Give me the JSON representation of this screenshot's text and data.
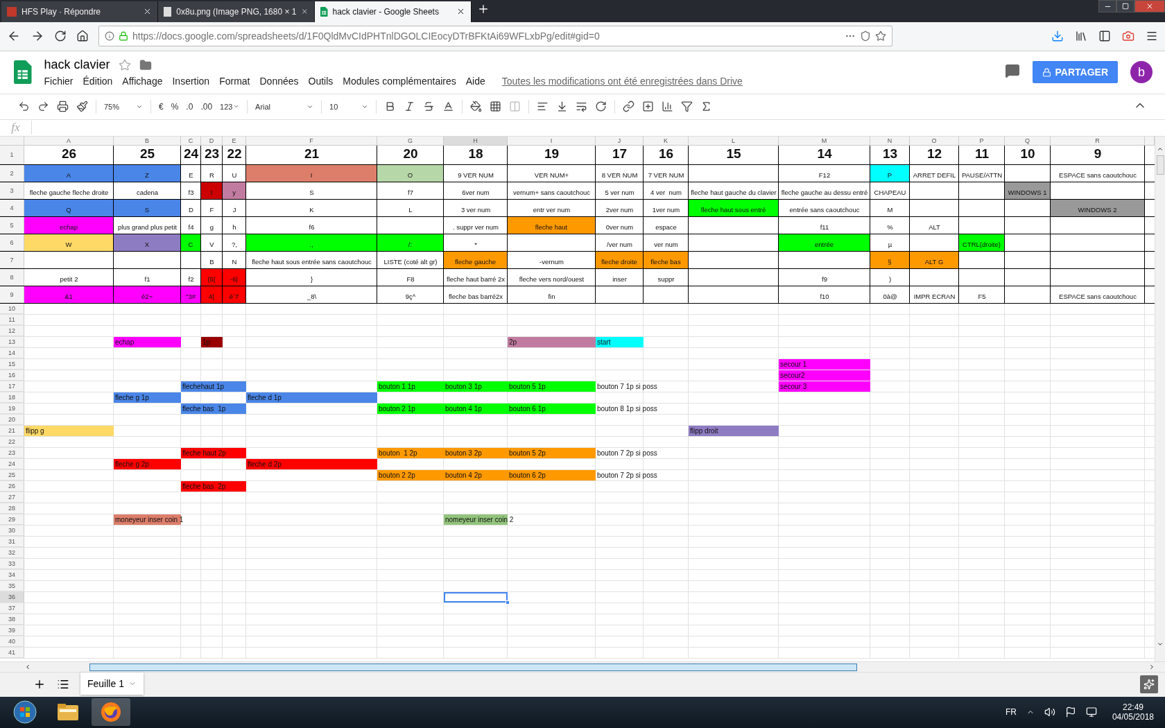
{
  "browser": {
    "tabs": [
      {
        "title": "HFS Play · Répondre",
        "selected": false
      },
      {
        "title": "0x8u.png (Image PNG, 1680 × 1",
        "selected": false
      },
      {
        "title": "hack clavier - Google Sheets",
        "selected": true
      }
    ],
    "url": "https://docs.google.com/spreadsheets/d/1F0QldMvCIdPHTnlDGOLCIEocyDTrBFKtAi69WFLxbPg/edit#gid=0"
  },
  "document": {
    "title": "hack clavier",
    "menus": [
      "Fichier",
      "Édition",
      "Affichage",
      "Insertion",
      "Format",
      "Données",
      "Outils",
      "Modules complémentaires",
      "Aide"
    ],
    "save_status": "Toutes les modifications ont été enregistrées dans Drive",
    "share": "PARTAGER",
    "avatar": "b"
  },
  "toolbar": {
    "zoom": "75%",
    "currency": "€",
    "percent": "%",
    "decrease_decimals": ".0",
    "increase_decimals": ".00",
    "number_format": "123",
    "font": "Arial",
    "font_size": "10"
  },
  "formula_bar": {
    "label": "fx"
  },
  "grid": {
    "columns": [
      {
        "letter": "A",
        "selected": false
      },
      {
        "letter": "B",
        "selected": false
      },
      {
        "letter": "C",
        "selected": false
      },
      {
        "letter": "D",
        "selected": false
      },
      {
        "letter": "E",
        "selected": false
      },
      {
        "letter": "F",
        "selected": false
      },
      {
        "letter": "G",
        "selected": false
      },
      {
        "letter": "H",
        "selected": true
      },
      {
        "letter": "I",
        "selected": false
      },
      {
        "letter": "J",
        "selected": false
      },
      {
        "letter": "K",
        "selected": false
      },
      {
        "letter": "L",
        "selected": false
      },
      {
        "letter": "M",
        "selected": false
      },
      {
        "letter": "N",
        "selected": false
      },
      {
        "letter": "O",
        "selected": false
      },
      {
        "letter": "P",
        "selected": false
      },
      {
        "letter": "Q",
        "selected": false
      },
      {
        "letter": "R",
        "selected": false
      }
    ],
    "rows": [
      {
        "number": "1",
        "kind": "title",
        "selected": false,
        "cells": [
          "26",
          "25",
          "24",
          "23",
          "22",
          "21",
          "20",
          "18",
          "19",
          "17",
          "16",
          "15",
          "14",
          "13",
          "12",
          "11",
          "10",
          "9"
        ]
      },
      {
        "number": "2",
        "kind": "key",
        "selected": false,
        "cells": [
          {
            "text": "A",
            "color": "#4a86e8"
          },
          {
            "text": "Z",
            "color": "#4a86e8"
          },
          "E",
          "R",
          "U",
          {
            "text": "I",
            "color": "#dd7e6b"
          },
          {
            "text": "O",
            "color": "#b6d7a8"
          },
          "9 VER NUM",
          "VER NUM+",
          "8 VER NUM",
          "7 VER NUM",
          null,
          "F12",
          {
            "text": "P",
            "color": "#00ffff"
          },
          "ARRET DEFIL",
          "PAUSE/ATTN",
          null,
          "ESPACE sans caoutchouc"
        ]
      },
      {
        "number": "3",
        "kind": "key",
        "selected": false,
        "cells": [
          "fleche gauche fleche droite",
          "cadena",
          "f3",
          {
            "text": "t",
            "color": "#cc0000"
          },
          {
            "text": "y",
            "color": "#c27ba0"
          },
          "S",
          "f7",
          "6ver num",
          "vernum+ sans caoutchouc",
          "5 ver num",
          "4 ver  num",
          "fleche haut gauche du clavier",
          "fleche gauche au dessu entré",
          "CHAPEAU",
          null,
          null,
          {
            "text": "WINDOWS 1",
            "color": "#999999"
          },
          null
        ]
      },
      {
        "number": "4",
        "kind": "key",
        "selected": false,
        "cells": [
          {
            "text": "Q",
            "color": "#4a86e8"
          },
          {
            "text": "S",
            "color": "#4a86e8"
          },
          "D",
          "F",
          "J",
          "K",
          "L",
          "3 ver num",
          "entr ver num",
          "2ver num",
          "1ver num",
          {
            "text": "fleche haut sous entré",
            "color": "#00ff00"
          },
          "entrée sans caoutchouc",
          "M",
          null,
          null,
          null,
          {
            "text": "WINDOWS 2",
            "color": "#999999"
          }
        ]
      },
      {
        "number": "5",
        "kind": "key",
        "selected": false,
        "cells": [
          {
            "text": "echap",
            "color": "#ff00ff"
          },
          "plus grand plus petit",
          "f4",
          "g",
          "h",
          "f6",
          null,
          ". suppr ver num",
          {
            "text": "fleche haut",
            "color": "#ff9900"
          },
          "0ver num",
          "espace",
          null,
          "f11",
          "%",
          "ALT",
          null,
          null,
          null
        ]
      },
      {
        "number": "6",
        "kind": "key",
        "selected": false,
        "cells": [
          {
            "text": "W",
            "color": "#ffd966"
          },
          {
            "text": "X",
            "color": "#8e7cc3"
          },
          {
            "text": "C",
            "color": "#00ff00"
          },
          "V",
          "?,",
          {
            "text": ".,",
            "color": "#00ff00"
          },
          {
            "text": "/:",
            "color": "#00ff00"
          },
          "*",
          null,
          "/ver num",
          "ver num",
          null,
          {
            "text": "entrée",
            "color": "#00ff00"
          },
          "µ",
          null,
          {
            "text": "CTRL(droite)",
            "color": "#00ff00"
          },
          null,
          null
        ]
      },
      {
        "number": "7",
        "kind": "key",
        "selected": false,
        "cells": [
          null,
          null,
          null,
          "B",
          "N",
          "fleche haut sous entrée sans caoutchouc",
          "LISTE (coté alt gr)",
          {
            "text": "fleche gauche",
            "color": "#ff9900"
          },
          "-vernum",
          {
            "text": "fleche droite",
            "color": "#ff9900"
          },
          {
            "text": "fleche bas",
            "color": "#ff9900"
          },
          null,
          null,
          {
            "text": "§",
            "color": "#ff9900"
          },
          {
            "text": "ALT G",
            "color": "#ff9900"
          },
          null,
          null,
          null
        ]
      },
      {
        "number": "8",
        "kind": "key",
        "selected": false,
        "cells": [
          "petit 2",
          "f1",
          "f2",
          {
            "text": "(5[",
            "color": "#ff0000"
          },
          {
            "text": "-6|",
            "color": "#ff0000"
          },
          "}",
          "F8",
          "fleche haut barré 2x",
          "fleche vers nord/ouest",
          "inser",
          "suppr",
          null,
          "f9",
          ")",
          null,
          null,
          null,
          null
        ]
      },
      {
        "number": "9",
        "kind": "key",
        "selected": false,
        "cells": [
          {
            "text": "&1",
            "color": "#ff00ff"
          },
          {
            "text": "é2~",
            "color": "#ff00ff"
          },
          {
            "text": "\"3#",
            "color": "#ff00ff"
          },
          {
            "text": "4{",
            "color": "#ff0000"
          },
          {
            "text": "è`7",
            "color": "#ff0000"
          },
          "_8\\",
          "9ç^",
          "fleche bas barré2x",
          "fin",
          null,
          null,
          null,
          "f10",
          "0à@",
          "IMPR ECRAN",
          "F5",
          null,
          "ESPACE sans caoutchouc"
        ]
      },
      {
        "number": "10",
        "kind": "plain",
        "selected": false
      },
      {
        "number": "11",
        "kind": "plain",
        "selected": false
      },
      {
        "number": "12",
        "kind": "plain",
        "selected": false
      },
      {
        "number": "13",
        "kind": "plain",
        "selected": false,
        "cells": [
          null,
          {
            "text": "echap",
            "color": "#ff00ff"
          },
          null,
          {
            "text": "1p",
            "color": "#990000"
          },
          null,
          null,
          null,
          null,
          {
            "text": "2p",
            "color": "#c27ba0"
          },
          {
            "text": "start",
            "color": "#00ffff"
          }
        ]
      },
      {
        "number": "14",
        "kind": "plain",
        "selected": false
      },
      {
        "number": "15",
        "kind": "plain",
        "selected": false,
        "cells": [
          null,
          null,
          null,
          null,
          null,
          null,
          null,
          null,
          null,
          null,
          null,
          null,
          {
            "text": "secour 1",
            "color": "#ff00ff"
          }
        ]
      },
      {
        "number": "16",
        "kind": "plain",
        "selected": false,
        "cells": [
          null,
          null,
          null,
          null,
          null,
          null,
          null,
          null,
          null,
          null,
          null,
          null,
          {
            "text": "secour2",
            "color": "#ff00ff"
          }
        ]
      },
      {
        "number": "17",
        "kind": "plain",
        "selected": false,
        "cells": [
          null,
          null,
          {
            "text": "flechehaut 1p",
            "color": "#4a86e8"
          },
          {
            "color": "#4a86e8"
          },
          {
            "color": "#4a86e8"
          },
          null,
          {
            "text": "bouton 1 1p",
            "color": "#00ff00"
          },
          {
            "text": "bouton 3 1p",
            "color": "#00ff00"
          },
          {
            "text": "bouton 5 1p",
            "color": "#00ff00"
          },
          "bouton 7 1p si poss",
          null,
          null,
          {
            "text": "secour 3",
            "color": "#ff00ff"
          }
        ]
      },
      {
        "number": "18",
        "kind": "plain",
        "selected": false,
        "cells": [
          null,
          {
            "text": "fleche g 1p",
            "color": "#4a86e8"
          },
          null,
          null,
          null,
          {
            "text": "fleche d 1p",
            "color": "#4a86e8"
          }
        ]
      },
      {
        "number": "19",
        "kind": "plain",
        "selected": false,
        "cells": [
          null,
          null,
          {
            "text": "fleche bas  1p",
            "color": "#4a86e8"
          },
          {
            "color": "#4a86e8"
          },
          {
            "color": "#4a86e8"
          },
          null,
          {
            "text": "bouton 2 1p",
            "color": "#00ff00"
          },
          {
            "text": "bouton 4 1p",
            "color": "#00ff00"
          },
          {
            "text": "bouton 6 1p",
            "color": "#00ff00"
          },
          "bouton 8 1p si poss"
        ]
      },
      {
        "number": "20",
        "kind": "plain",
        "selected": false
      },
      {
        "number": "21",
        "kind": "plain",
        "selected": false,
        "cells": [
          {
            "text": "flipp g",
            "color": "#ffd966"
          },
          null,
          null,
          null,
          null,
          null,
          null,
          null,
          null,
          null,
          null,
          {
            "text": "flipp droit",
            "color": "#8e7cc3"
          }
        ]
      },
      {
        "number": "22",
        "kind": "plain",
        "selected": false
      },
      {
        "number": "23",
        "kind": "plain",
        "selected": false,
        "cells": [
          null,
          null,
          {
            "text": "fleche haut 2p",
            "color": "#ff0000"
          },
          {
            "color": "#ff0000"
          },
          {
            "color": "#ff0000"
          },
          null,
          {
            "text": "bouton  1 2p",
            "color": "#ff9900"
          },
          {
            "text": "bouton 3 2p",
            "color": "#ff9900"
          },
          {
            "text": "bouton 5 2p",
            "color": "#ff9900"
          },
          "bouton 7 2p si poss"
        ]
      },
      {
        "number": "24",
        "kind": "plain",
        "selected": false,
        "cells": [
          null,
          {
            "text": "fleche g 2p",
            "color": "#ff0000"
          },
          null,
          null,
          null,
          {
            "text": "fleche d 2p",
            "color": "#ff0000"
          }
        ]
      },
      {
        "number": "25",
        "kind": "plain",
        "selected": false,
        "cells": [
          null,
          null,
          null,
          null,
          null,
          null,
          {
            "text": "bouton 2 2p",
            "color": "#ff9900"
          },
          {
            "text": "bouton 4 2p",
            "color": "#ff9900"
          },
          {
            "text": "bouton 6 2p",
            "color": "#ff9900"
          },
          "bouton 7 2p si poss"
        ]
      },
      {
        "number": "26",
        "kind": "plain",
        "selected": false,
        "cells": [
          null,
          null,
          {
            "text": "fleche bas  2p",
            "color": "#ff0000"
          },
          {
            "color": "#ff0000"
          },
          {
            "color": "#ff0000"
          }
        ]
      },
      {
        "number": "27",
        "kind": "plain",
        "selected": false
      },
      {
        "number": "28",
        "kind": "plain",
        "selected": false
      },
      {
        "number": "29",
        "kind": "plain",
        "selected": false,
        "cells": [
          null,
          {
            "text": "moneyeur inser coin 1",
            "color": "#dd7e6b"
          },
          null,
          null,
          null,
          null,
          null,
          {
            "text": "nomeyeur inser coin 2",
            "color": "#93c47d"
          }
        ]
      },
      {
        "number": "30",
        "kind": "plain",
        "selected": false
      },
      {
        "number": "31",
        "kind": "plain",
        "selected": false
      },
      {
        "number": "32",
        "kind": "plain",
        "selected": false
      },
      {
        "number": "33",
        "kind": "plain",
        "selected": false
      },
      {
        "number": "34",
        "kind": "plain",
        "selected": false
      },
      {
        "number": "35",
        "kind": "plain",
        "selected": false
      },
      {
        "number": "36",
        "kind": "plain",
        "selected": true
      },
      {
        "number": "37",
        "kind": "plain",
        "selected": false
      },
      {
        "number": "38",
        "kind": "plain",
        "selected": false
      },
      {
        "number": "39",
        "kind": "plain",
        "selected": false
      },
      {
        "number": "40",
        "kind": "plain",
        "selected": false
      },
      {
        "number": "41",
        "kind": "plain",
        "selected": false
      }
    ]
  },
  "sheets": [
    {
      "name": "Feuille 1",
      "selected": true
    }
  ],
  "taskbar": {
    "language": "FR",
    "time": "22:49",
    "date": "04/05/2018"
  }
}
